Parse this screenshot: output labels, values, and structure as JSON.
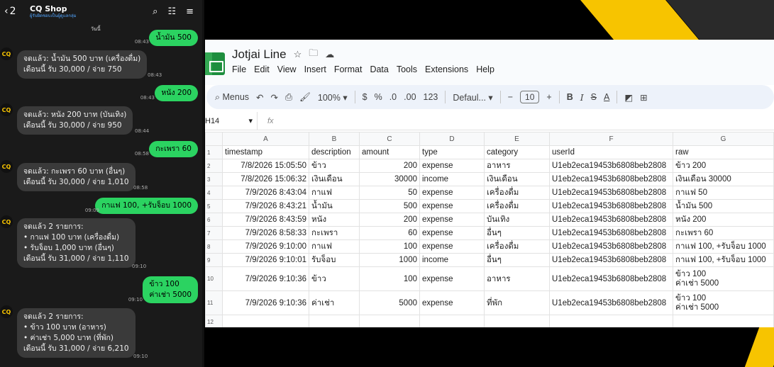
{
  "chat": {
    "header": {
      "back_count": "2",
      "title": "CQ Shop",
      "subtitle": "ผู้รับผิดชอบเป็นผู้ดูแลกลุ่ม"
    },
    "divider": "วันนี้",
    "avatar_label": "CQ",
    "messages": [
      {
        "dir": "out",
        "text": "น้ำมัน 500",
        "time": "08:43"
      },
      {
        "dir": "in",
        "text": "จดแล้ว: น้ำมัน 500 บาท (เครื่องดื่ม)\nเดือนนี้ รับ 30,000 / จ่าย 750",
        "time": "08:43"
      },
      {
        "dir": "out",
        "text": "หนัง 200",
        "time": "08:43"
      },
      {
        "dir": "in",
        "text": "จดแล้ว: หนัง 200 บาท (บันเทิง)\nเดือนนี้ รับ 30,000 / จ่าย 950",
        "time": "08:44"
      },
      {
        "dir": "out",
        "text": "กะเพรา 60",
        "time": "08:58"
      },
      {
        "dir": "in",
        "text": "จดแล้ว: กะเพรา 60 บาท (อื่นๆ)\nเดือนนี้ รับ 30,000 / จ่าย 1,010",
        "time": "08:58"
      },
      {
        "dir": "out",
        "text": "กาแฟ 100, +รับจ็อบ 1000",
        "time": "09:09"
      },
      {
        "dir": "in",
        "text": "จดแล้ว 2 รายการ:\n• กาแฟ 100 บาท (เครื่องดื่ม)\n• รับจ็อบ 1,000 บาท (อื่นๆ)\nเดือนนี้ รับ 31,000 / จ่าย 1,110",
        "time": "09:10"
      },
      {
        "dir": "out",
        "text": "ข้าว 100\nค่าเช่า 5000",
        "time": "09:10"
      },
      {
        "dir": "in",
        "text": "จดแล้ว 2 รายการ:\n• ข้าว 100 บาท (อาหาร)\n• ค่าเช่า 5,000 บาท (ที่พัก)\nเดือนนี้ รับ 31,000 / จ่าย 6,210",
        "time": "09:10"
      }
    ]
  },
  "sheet": {
    "title": "Jotjai Line",
    "menu": [
      "File",
      "Edit",
      "View",
      "Insert",
      "Format",
      "Data",
      "Tools",
      "Extensions",
      "Help"
    ],
    "toolbar": {
      "search_label": "Menus",
      "zoom": "100%",
      "currency": "$",
      "percent": "%",
      "dec_less": ".0",
      "dec_more": ".00",
      "number_format": "123",
      "font": "Defaul...",
      "font_size": "10"
    },
    "name_box": "H14",
    "fx_label": "fx",
    "columns": [
      "A",
      "B",
      "C",
      "D",
      "E",
      "F",
      "G"
    ],
    "rows": [
      [
        "timestamp",
        "description",
        "amount",
        "type",
        "category",
        "userId",
        "raw"
      ],
      [
        "7/8/2026 15:05:50",
        "ข้าว",
        "200",
        "expense",
        "อาหาร",
        "U1eb2eca19453b6808beb2808",
        "ข้าว 200"
      ],
      [
        "7/8/2026 15:06:32",
        "เงินเดือน",
        "30000",
        "income",
        "เงินเดือน",
        "U1eb2eca19453b6808beb2808",
        "เงินเดือน 30000"
      ],
      [
        "7/9/2026 8:43:04",
        "กาแฟ",
        "50",
        "expense",
        "เครื่องดื่ม",
        "U1eb2eca19453b6808beb2808",
        "กาแฟ 50"
      ],
      [
        "7/9/2026 8:43:21",
        "น้ำมัน",
        "500",
        "expense",
        "เครื่องดื่ม",
        "U1eb2eca19453b6808beb2808",
        "น้ำมัน 500"
      ],
      [
        "7/9/2026 8:43:59",
        "หนัง",
        "200",
        "expense",
        "บันเทิง",
        "U1eb2eca19453b6808beb2808",
        "หนัง 200"
      ],
      [
        "7/9/2026 8:58:33",
        "กะเพรา",
        "60",
        "expense",
        "อื่นๆ",
        "U1eb2eca19453b6808beb2808",
        "กะเพรา 60"
      ],
      [
        "7/9/2026 9:10:00",
        "กาแฟ",
        "100",
        "expense",
        "เครื่องดื่ม",
        "U1eb2eca19453b6808beb2808",
        "กาแฟ 100, +รับจ็อบ 1000"
      ],
      [
        "7/9/2026 9:10:01",
        "รับจ็อบ",
        "1000",
        "income",
        "อื่นๆ",
        "U1eb2eca19453b6808beb2808",
        "กาแฟ 100, +รับจ็อบ 1000"
      ],
      [
        "7/9/2026 9:10:36",
        "ข้าว",
        "100",
        "expense",
        "อาหาร",
        "U1eb2eca19453b6808beb2808",
        "ข้าว 100\nค่าเช่า 5000"
      ],
      [
        "7/9/2026 9:10:36",
        "ค่าเช่า",
        "5000",
        "expense",
        "ที่พัก",
        "U1eb2eca19453b6808beb2808",
        "ข้าว 100\nค่าเช่า 5000"
      ],
      [
        "",
        "",
        "",
        "",
        "",
        "",
        ""
      ]
    ]
  }
}
